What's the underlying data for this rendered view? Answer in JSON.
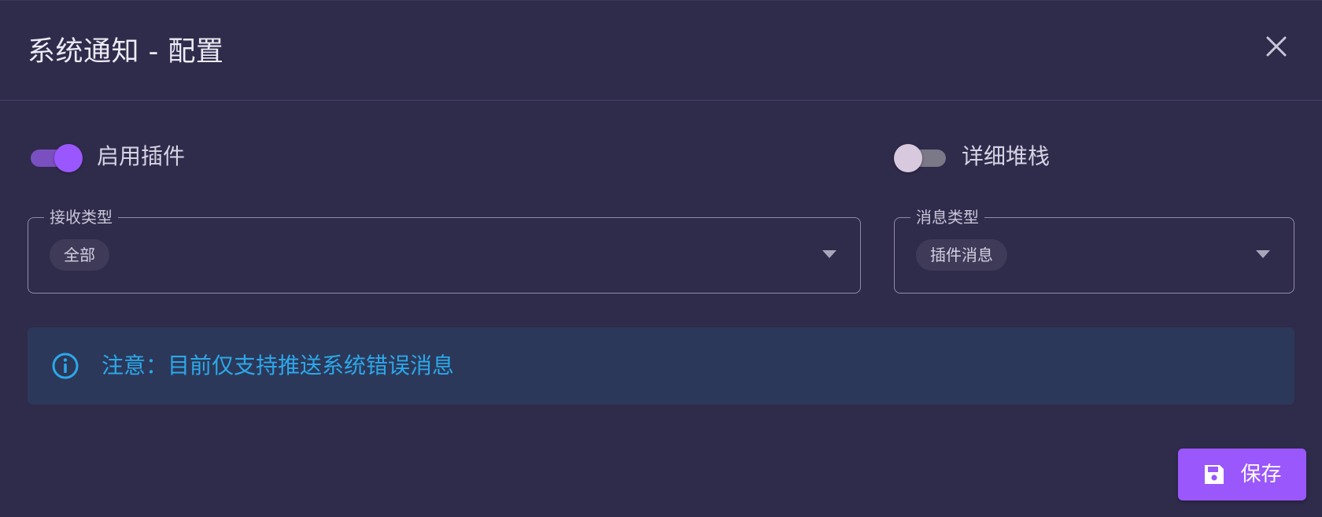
{
  "dialog": {
    "title": "系统通知 - 配置",
    "close_icon": "close-icon"
  },
  "toggles": {
    "enable_plugin": {
      "label": "启用插件",
      "on": true
    },
    "detailed_stack": {
      "label": "详细堆栈",
      "on": false
    }
  },
  "fields": {
    "receive_type": {
      "label": "接收类型",
      "selected": [
        "全部"
      ]
    },
    "message_type": {
      "label": "消息类型",
      "selected": [
        "插件消息"
      ]
    }
  },
  "alert": {
    "icon": "info-icon",
    "text": "注意：目前仅支持推送系统错误消息"
  },
  "actions": {
    "save_label": "保存",
    "save_icon": "floppy-disk-icon"
  },
  "colors": {
    "background": "#2f2b4b",
    "accent": "#9a57fc",
    "alert_bg": "#2c3859",
    "alert_text": "#2ba8ea"
  }
}
